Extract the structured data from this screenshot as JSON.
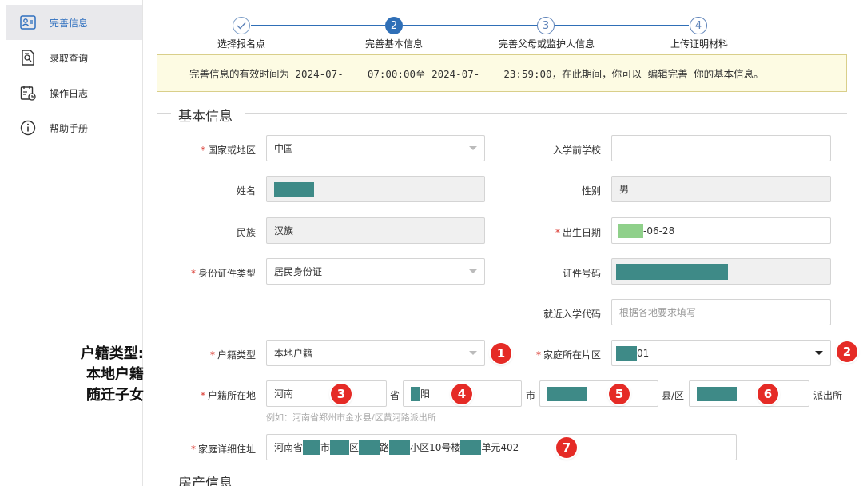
{
  "sidebar": {
    "items": [
      {
        "label": "完善信息",
        "icon": "id-card-icon",
        "active": true
      },
      {
        "label": "录取查询",
        "icon": "document-search-icon",
        "active": false
      },
      {
        "label": "操作日志",
        "icon": "calendar-log-icon",
        "active": false
      },
      {
        "label": "帮助手册",
        "icon": "info-circle-icon",
        "active": false
      }
    ]
  },
  "annotation": {
    "line1": "户籍类型:",
    "line2": "本地户籍",
    "line3": "随迁子女"
  },
  "stepper": {
    "steps": [
      {
        "number": "✓",
        "label": "选择报名点",
        "state": "done"
      },
      {
        "number": "2",
        "label": "完善基本信息",
        "state": "active"
      },
      {
        "number": "3",
        "label": "完善父母或监护人信息",
        "state": "todo"
      },
      {
        "number": "4",
        "label": "上传证明材料",
        "state": "todo"
      }
    ]
  },
  "notice": {
    "text": "完善信息的有效时间为 2024-07-    07:00:00至 2024-07-    23:59:00，在此期间，你可以 编辑完善 你的基本信息。"
  },
  "sections": {
    "basic": "基本信息",
    "property": "房产信息"
  },
  "form": {
    "country": {
      "label": "国家或地区",
      "value": "中国"
    },
    "preschool": {
      "label": "入学前学校",
      "value": ""
    },
    "name": {
      "label": "姓名"
    },
    "gender": {
      "label": "性别",
      "value": "男"
    },
    "ethnicity": {
      "label": "民族",
      "value": "汉族"
    },
    "birthdate": {
      "label": "出生日期",
      "value_suffix": "-06-28"
    },
    "id_type": {
      "label": "身份证件类型",
      "value": "居民身份证"
    },
    "id_number": {
      "label": "证件号码"
    },
    "enroll_code": {
      "label": "就近入学代码",
      "placeholder": "根据各地要求填写"
    },
    "hukou_type": {
      "label": "户籍类型",
      "value": "本地户籍"
    },
    "home_district": {
      "label": "家庭所在片区",
      "value_suffix": "01"
    },
    "hukou_location": {
      "label": "户籍所在地",
      "province": "河南",
      "province_unit": "省",
      "city_suffix": "阳",
      "city_unit": "市",
      "county_unit": "县/区",
      "police_unit": "派出所",
      "hint": "例如：河南省郑州市金水县/区黄河路派出所"
    },
    "address": {
      "label": "家庭详细住址",
      "p1": "河南省",
      "p2": "市",
      "p3": "区",
      "p4": "路",
      "p5": "小区10号楼",
      "p6": "单元402"
    }
  },
  "markers": [
    "1",
    "2",
    "3",
    "4",
    "5",
    "6",
    "7"
  ],
  "colors": {
    "accent": "#2f6fb7",
    "required": "#d9342b",
    "marker": "#e52b26",
    "redaction": "#3e8a87",
    "notice_bg": "#fdfbe3"
  }
}
